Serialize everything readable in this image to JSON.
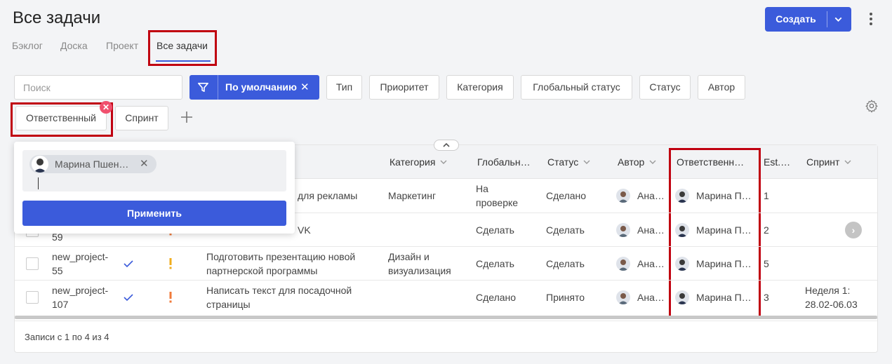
{
  "header": {
    "title": "Все задачи",
    "create_label": "Создать"
  },
  "tabs": [
    {
      "label": "Бэклог"
    },
    {
      "label": "Доска"
    },
    {
      "label": "Проект"
    },
    {
      "label": "Все задачи",
      "active": true
    }
  ],
  "toolbar": {
    "search_placeholder": "Поиск",
    "preset_label": "По умолчанию",
    "chips": [
      "Тип",
      "Приоритет",
      "Категория",
      "Глобальный статус",
      "Статус",
      "Автор"
    ],
    "assignee_chip": "Ответственный",
    "sprint_chip": "Спринт"
  },
  "popup": {
    "tag_label": "Марина Пшен…",
    "apply_label": "Применить"
  },
  "table": {
    "columns": [
      "Категория",
      "Глобальн…",
      "Статус",
      "Автор",
      "Ответственн…",
      "Est.…",
      "Спринт"
    ],
    "rows": [
      {
        "id": "",
        "title_tail": "для рекламы",
        "category": "Маркетинг",
        "global_status": "На проверке",
        "status": "Сделано",
        "author": "Ана…",
        "assignee": "Марина П…",
        "est": "1",
        "sprint": ""
      },
      {
        "id": "59",
        "title_tail": "VK",
        "category": "",
        "global_status": "Сделать",
        "status": "Сделать",
        "author": "Ана…",
        "assignee": "Марина П…",
        "est": "2",
        "sprint": ""
      },
      {
        "id": "new_project-55",
        "title": "Подготовить презентацию новой партнерской программы",
        "category": "Дизайн и визуализация",
        "global_status": "Сделать",
        "status": "Сделать",
        "author": "Ана…",
        "assignee": "Марина П…",
        "est": "5",
        "sprint": ""
      },
      {
        "id": "new_project-107",
        "title": "Написать текст для посадочной страницы",
        "category": "",
        "global_status": "Сделано",
        "status": "Принято",
        "author": "Ана…",
        "assignee": "Марина П…",
        "est": "3",
        "sprint": "Неделя 1: 28.02-06.03"
      }
    ]
  },
  "footer": {
    "records": "Записи с 1 по 4 из 4"
  },
  "colors": {
    "accent": "#3b5bdb",
    "highlight_box": "#c00010",
    "badge": "#f0506e",
    "priority_high": "#f0ad1e",
    "priority_medium": "#f07a3a",
    "check": "#3b5bdb"
  }
}
